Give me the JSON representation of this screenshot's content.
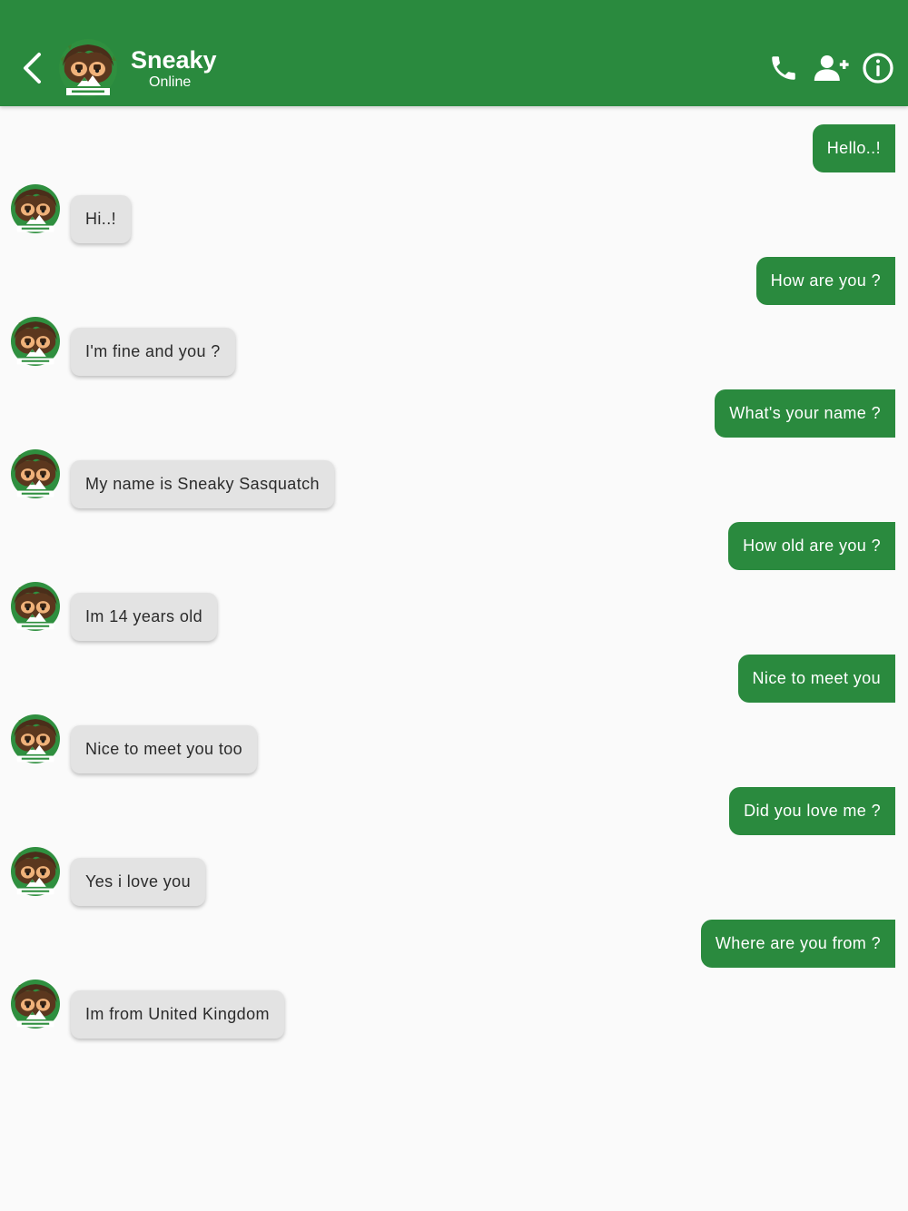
{
  "header": {
    "title": "Sneaky",
    "status": "Online",
    "icons": {
      "back": "back-arrow-icon",
      "avatar": "sasquatch-avatar",
      "call": "phone-icon",
      "add_contact": "add-person-icon",
      "info": "info-icon"
    },
    "avatar_caption": "SASQUATCH"
  },
  "colors": {
    "primary": "#2a8a3e",
    "incoming_bubble": "#e3e3e3",
    "background": "#fafafa"
  },
  "messages": [
    {
      "from": "me",
      "text": "Hello..!"
    },
    {
      "from": "contact",
      "text": "Hi..!"
    },
    {
      "from": "me",
      "text": "How are you ?"
    },
    {
      "from": "contact",
      "text": "I'm fine and you ?"
    },
    {
      "from": "me",
      "text": "What's your name ?"
    },
    {
      "from": "contact",
      "text": "My name is Sneaky Sasquatch"
    },
    {
      "from": "me",
      "text": "How old are you ?"
    },
    {
      "from": "contact",
      "text": "Im 14 years old"
    },
    {
      "from": "me",
      "text": "Nice to meet you"
    },
    {
      "from": "contact",
      "text": "Nice to meet you too"
    },
    {
      "from": "me",
      "text": "Did you love me ?"
    },
    {
      "from": "contact",
      "text": "Yes i love you"
    },
    {
      "from": "me",
      "text": "Where are you from ?"
    },
    {
      "from": "contact",
      "text": "Im from United Kingdom"
    }
  ]
}
